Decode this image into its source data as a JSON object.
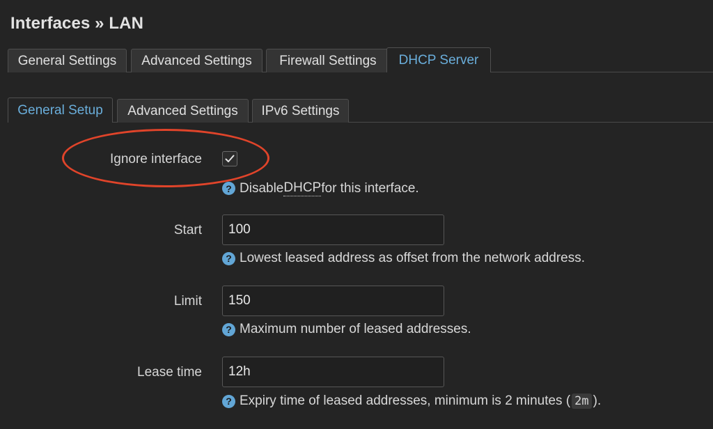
{
  "page": {
    "title": "Interfaces » LAN"
  },
  "main_tabs": [
    {
      "label": "General Settings"
    },
    {
      "label": "Advanced Settings"
    },
    {
      "label": "Firewall Settings"
    },
    {
      "label": "DHCP Server"
    }
  ],
  "main_tabs_active": "DHCP Server",
  "sub_tabs": [
    {
      "label": "General Setup"
    },
    {
      "label": "Advanced Settings"
    },
    {
      "label": "IPv6 Settings"
    }
  ],
  "sub_tabs_active": "General Setup",
  "form": {
    "ignore": {
      "label": "Ignore interface",
      "checked": true,
      "help_before": "Disable ",
      "help_abbr": "DHCP",
      "help_after": " for this interface."
    },
    "start": {
      "label": "Start",
      "value": "100",
      "help": "Lowest leased address as offset from the network address."
    },
    "limit": {
      "label": "Limit",
      "value": "150",
      "help": "Maximum number of leased addresses."
    },
    "leasetime": {
      "label": "Lease time",
      "value": "12h",
      "help_before": "Expiry time of leased addresses, minimum is 2 minutes (",
      "help_code": "2m",
      "help_after": ")."
    }
  },
  "icons": {
    "help": "question-circle-icon",
    "check": "checkmark-icon"
  },
  "colors": {
    "accent": "#6aaedb",
    "annotation": "#e0442a",
    "background": "#242424"
  }
}
